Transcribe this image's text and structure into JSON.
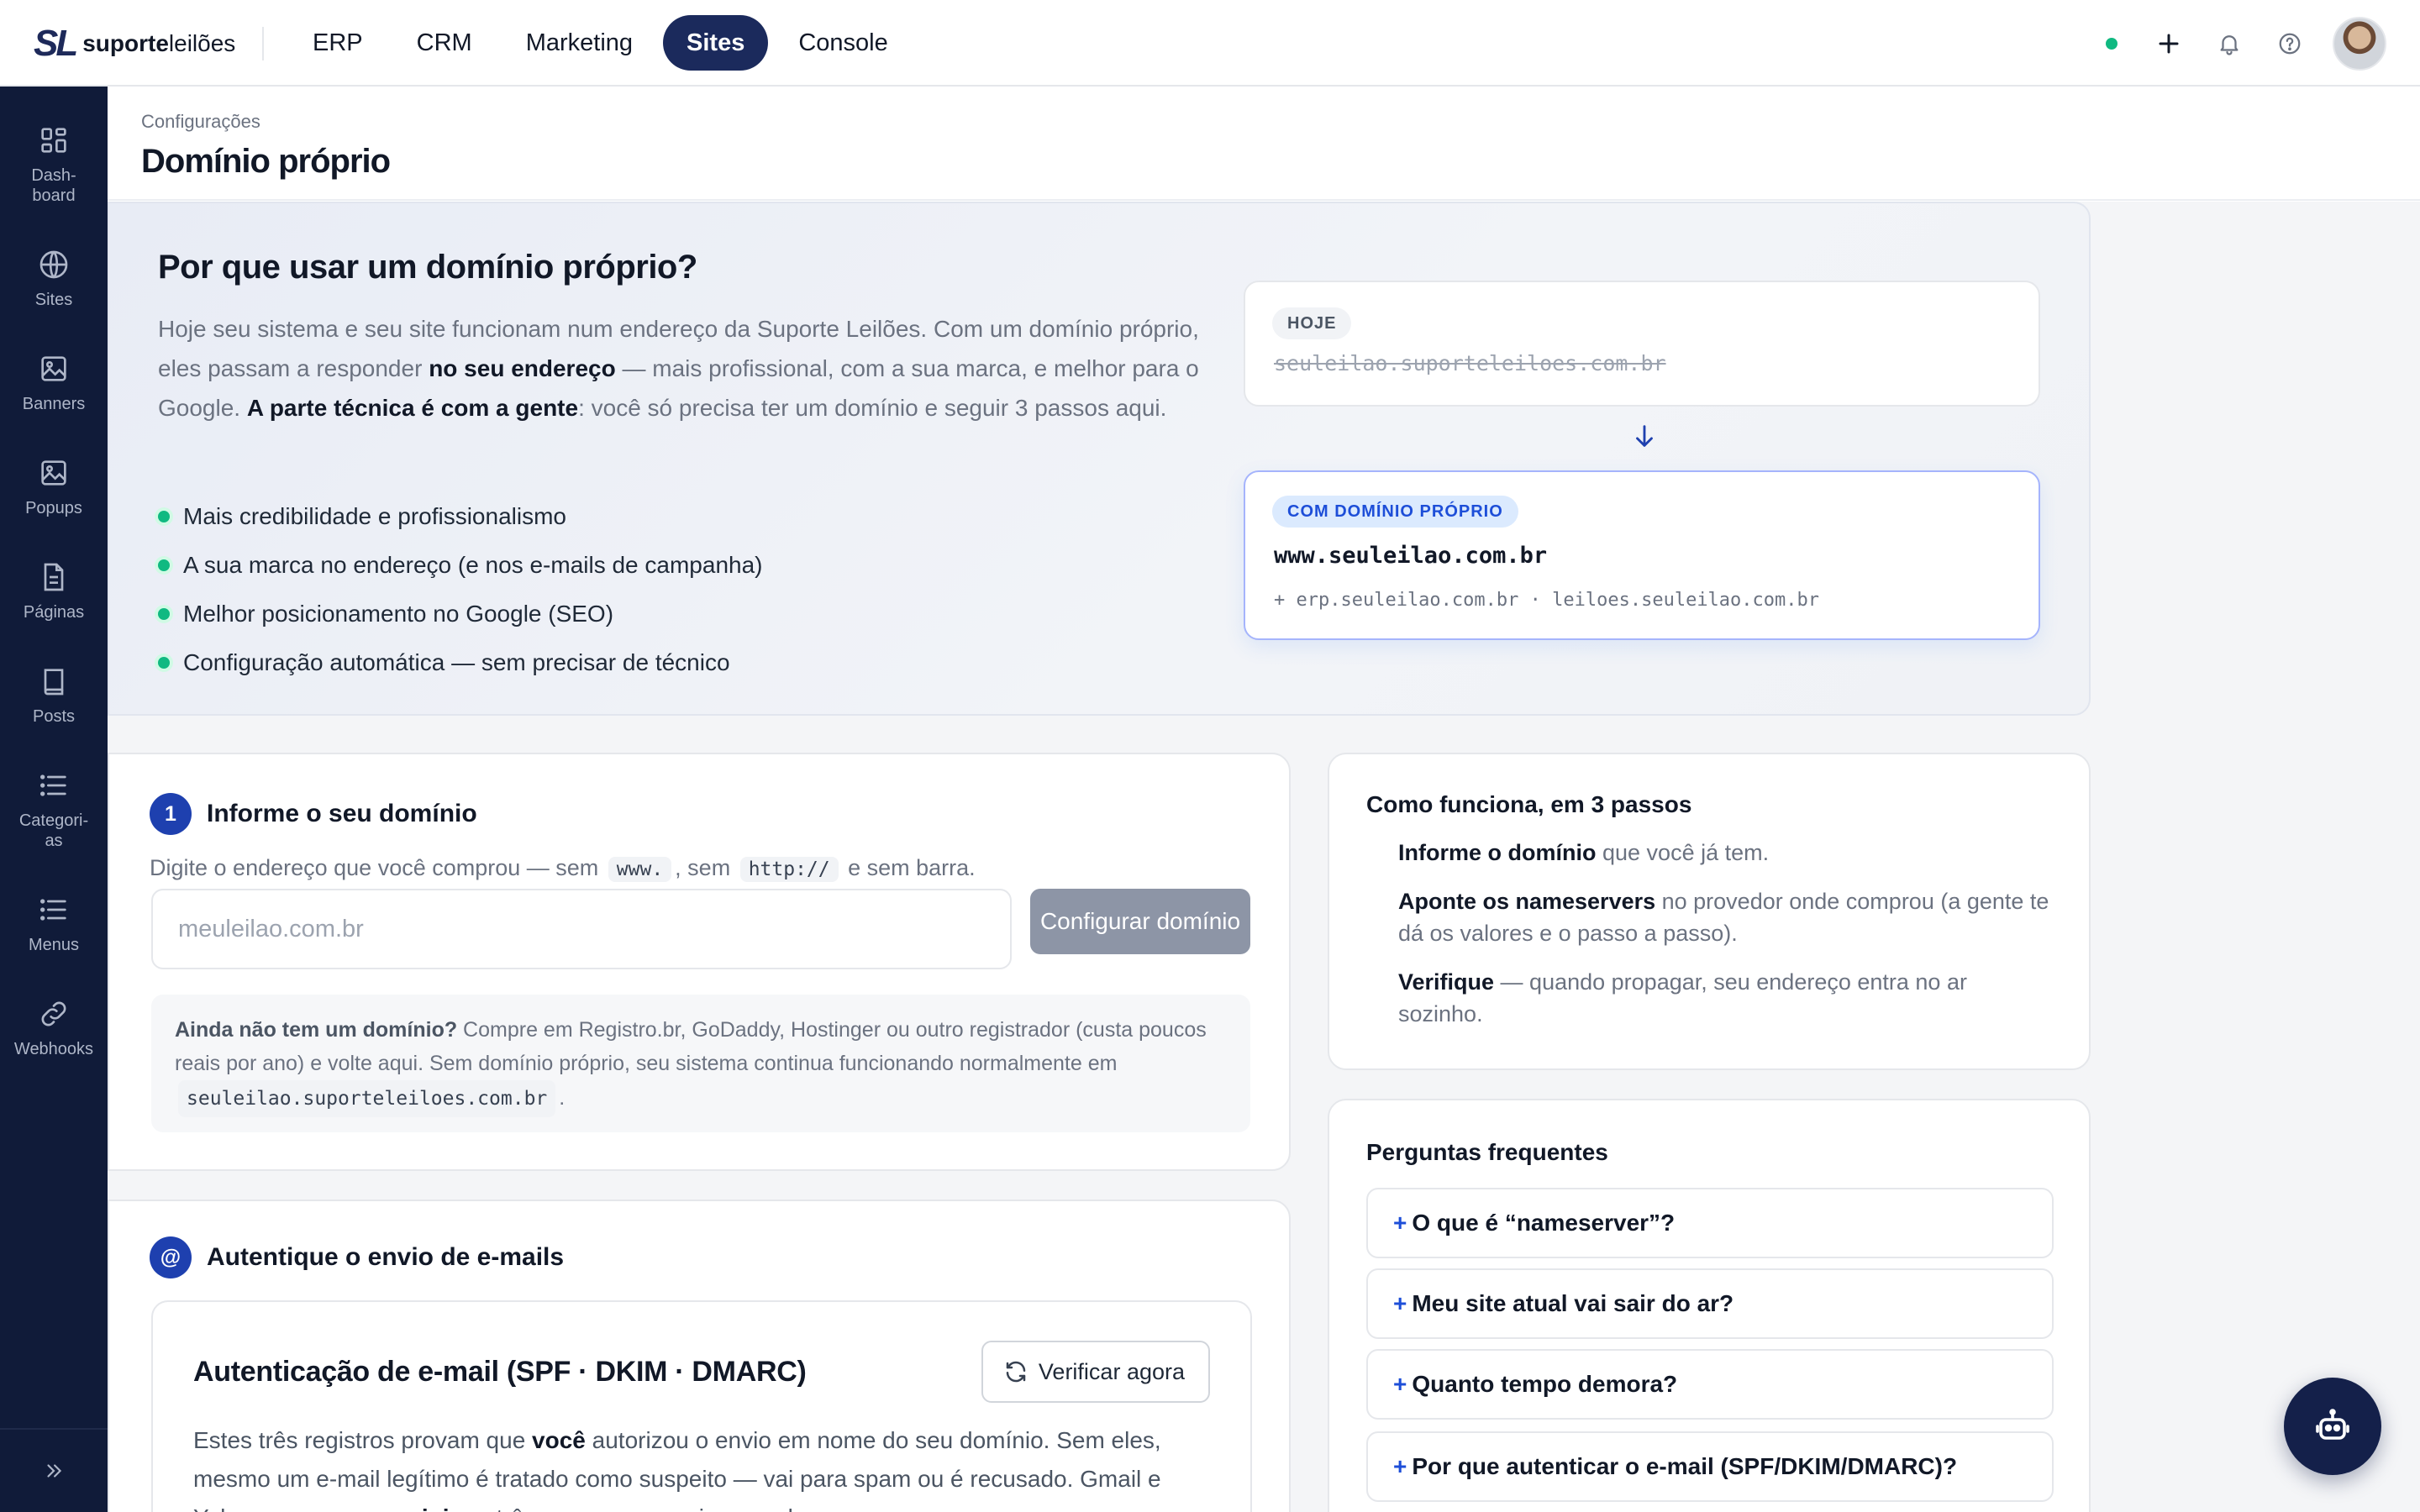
{
  "brand": {
    "mark": "SL",
    "name_bold": "suporte",
    "name_light": "leilões"
  },
  "nav": [
    {
      "label": "ERP"
    },
    {
      "label": "CRM"
    },
    {
      "label": "Marketing"
    },
    {
      "label": "Sites",
      "active": true
    },
    {
      "label": "Console"
    }
  ],
  "topbar": {
    "icons": [
      "status-dot",
      "plus-icon",
      "bell-icon",
      "help-icon",
      "avatar"
    ]
  },
  "sidebar": {
    "items": [
      {
        "label": "Dash-\nboard",
        "l1": "Dash-",
        "l2": "board",
        "icon": "grid-icon"
      },
      {
        "label": "Sites",
        "icon": "globe-icon"
      },
      {
        "label": "Banners",
        "icon": "image-icon"
      },
      {
        "label": "Popups",
        "icon": "image-icon"
      },
      {
        "label": "Páginas",
        "icon": "file-icon"
      },
      {
        "label": "Posts",
        "icon": "book-icon"
      },
      {
        "label": "Categori-\nas",
        "l1": "Categori-",
        "l2": "as",
        "icon": "list-icon"
      },
      {
        "label": "Menus",
        "icon": "list-icon"
      },
      {
        "label": "Webhooks",
        "icon": "link-icon"
      }
    ]
  },
  "page": {
    "breadcrumb": "Configurações",
    "title": "Domínio próprio"
  },
  "hero": {
    "title": "Por que usar um domínio próprio?",
    "desc_1": "Hoje seu sistema e seu site funcionam num endereço da Suporte Leilões. Com um domínio próprio, eles passam a responder ",
    "desc_b1": "no seu endereço",
    "desc_2": " — mais profissional, com a sua marca, e melhor para o Google. ",
    "desc_b2": "A parte técnica é com a gente",
    "desc_3": ": você só precisa ter um domínio e seguir 3 passos aqui.",
    "benefits": [
      "Mais credibilidade e profissionalismo",
      "A sua marca no endereço (e nos e-mails de campanha)",
      "Melhor posicionamento no Google (SEO)",
      "Configuração automática — sem precisar de técnico"
    ],
    "today_badge": "HOJE",
    "today_url": "seuleilao.suporteleiloes.com.br",
    "own_badge": "COM DOMÍNIO PRÓPRIO",
    "own_url": "www.seuleilao.com.br",
    "own_sub": "+ erp.seuleilao.com.br · leiloes.seuleilao.com.br"
  },
  "step1": {
    "number": "1",
    "title": "Informe o seu domínio",
    "desc_a": "Digite o endereço que você comprou — sem ",
    "chip_www": "www.",
    "desc_b": ", sem ",
    "chip_http": "http://",
    "desc_c": " e sem barra.",
    "input_placeholder": "meuleilao.com.br",
    "button": "Configurar domínio",
    "note_bold": "Ainda não tem um domínio?",
    "note_text": " Compre em Registro.br, GoDaddy, Hostinger ou outro registrador (custa poucos reais por ano) e volte aqui. Sem domínio próprio, seu sistema continua funcionando normalmente em ",
    "note_chip": "seuleilao.suporteleiloes.com.br",
    "note_end": "."
  },
  "email": {
    "badge": "@",
    "title": "Autentique o envio de e-mails",
    "inner_title": "Autenticação de e-mail (SPF · DKIM · DMARC)",
    "verify_button": "Verificar agora",
    "desc_1": "Estes três registros provam que ",
    "desc_b1": "você",
    "desc_2": " autorizou o envio em nome do seu domínio. Sem eles, mesmo um e-mail legítimo é tratado como suspeito — vai para spam ou é recusado. Gmail e Yahoo passaram a ",
    "desc_b2": "exigir",
    "desc_3": " os três para quem envia em volume."
  },
  "how": {
    "title": "Como funciona, em 3 passos",
    "steps": [
      {
        "bold": "Informe o domínio",
        "text": " que você já tem."
      },
      {
        "bold": "Aponte os nameservers",
        "text": " no provedor onde comprou (a gente te dá os valores e o passo a passo)."
      },
      {
        "bold": "Verifique",
        "text": " — quando propagar, seu endereço entra no ar sozinho."
      }
    ]
  },
  "faq": {
    "title": "Perguntas frequentes",
    "items": [
      "O que é “nameserver”?",
      "Meu site atual vai sair do ar?",
      "Quanto tempo demora?",
      "Por que autenticar o e-mail (SPF/DKIM/DMARC)?"
    ],
    "plus": "+"
  },
  "colors": {
    "accent": "#1e40af",
    "nav_active": "#1b2a5c",
    "sidebar": "#101b39",
    "success": "#10b981"
  }
}
